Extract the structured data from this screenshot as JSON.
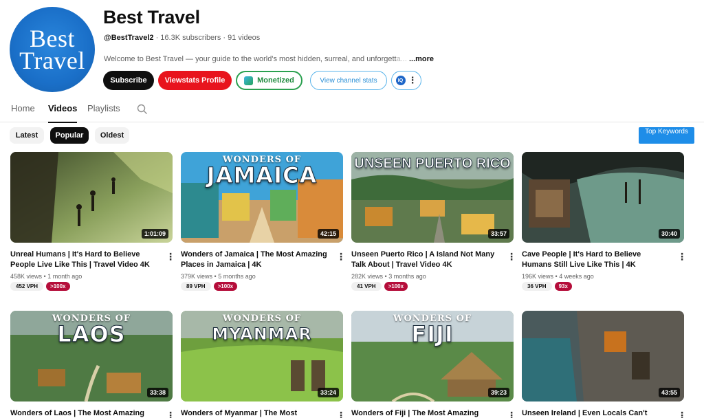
{
  "channel": {
    "avatar_line1": "Best",
    "avatar_line2": "Travel",
    "name": "Best Travel",
    "handle": "@BestTravel2",
    "subscribers": "16.3K subscribers",
    "videos_count": "91 videos",
    "description": "Welcome to Best Travel — your guide to the world's most hidden, surreal, and unforgett",
    "description_fade": "a...",
    "more": "...more"
  },
  "actions": {
    "subscribe": "Subscribe",
    "viewstats": "Viewstats Profile",
    "monetized": "Monetized",
    "channel_stats": "View channel stats",
    "extension_icon": "IQ"
  },
  "tabs": [
    "Home",
    "Videos",
    "Playlists"
  ],
  "active_tab": "Videos",
  "chips": [
    "Latest",
    "Popular",
    "Oldest"
  ],
  "active_chip": "Popular",
  "top_keywords": "Top Keywords",
  "colors": {
    "subscribe": "#0f0f0f",
    "viewstats": "#e8141d",
    "monetized": "#2aa04f",
    "stats": "#58b3ea",
    "multiplier": "#b50d3a",
    "top_keywords": "#1e8de8"
  },
  "videos": [
    {
      "title": "Unreal Humans | It's Hard to Believe People Live Like This | Travel Video 4K",
      "views": "458K views",
      "age": "1 month ago",
      "duration": "1:01:09",
      "vph": "452 VPH",
      "multiplier": ">100x",
      "thumb_text1": "",
      "thumb_text2": ""
    },
    {
      "title": "Wonders of Jamaica | The Most Amazing Places in Jamaica | 4K",
      "views": "379K views",
      "age": "5 months ago",
      "duration": "42:15",
      "vph": "89 VPH",
      "multiplier": ">100x",
      "thumb_text1": "WONDERS OF",
      "thumb_text2": "JAMAICA"
    },
    {
      "title": "Unseen Puerto Rico | A Island Not Many Talk About | Travel Video 4K",
      "views": "282K views",
      "age": "3 months ago",
      "duration": "33:57",
      "vph": "41 VPH",
      "multiplier": ">100x",
      "thumb_text1": "",
      "thumb_text2": "UNSEEN PUERTO RICO"
    },
    {
      "title": "Cave People | It's Hard to Believe Humans Still Live Like This | 4K",
      "views": "196K views",
      "age": "4 weeks ago",
      "duration": "30:40",
      "vph": "36 VPH",
      "multiplier": "93x",
      "thumb_text1": "",
      "thumb_text2": ""
    },
    {
      "title": "Wonders of Laos | The Most Amazing Places",
      "views": "",
      "age": "",
      "duration": "33:38",
      "vph": "",
      "multiplier": "",
      "thumb_text1": "WONDERS OF",
      "thumb_text2": "LAOS"
    },
    {
      "title": "Wonders of Myanmar | The Most Amazing",
      "views": "",
      "age": "",
      "duration": "33:24",
      "vph": "",
      "multiplier": "",
      "thumb_text1": "WONDERS OF",
      "thumb_text2": "MYANMAR"
    },
    {
      "title": "Wonders of Fiji | The Most Amazing Places",
      "views": "",
      "age": "",
      "duration": "39:23",
      "vph": "",
      "multiplier": "",
      "thumb_text1": "WONDERS OF",
      "thumb_text2": "FIJI"
    },
    {
      "title": "Unseen Ireland | Even Locals Can't Believe",
      "views": "",
      "age": "",
      "duration": "43:55",
      "vph": "",
      "multiplier": "",
      "thumb_text1": "",
      "thumb_text2": ""
    }
  ]
}
